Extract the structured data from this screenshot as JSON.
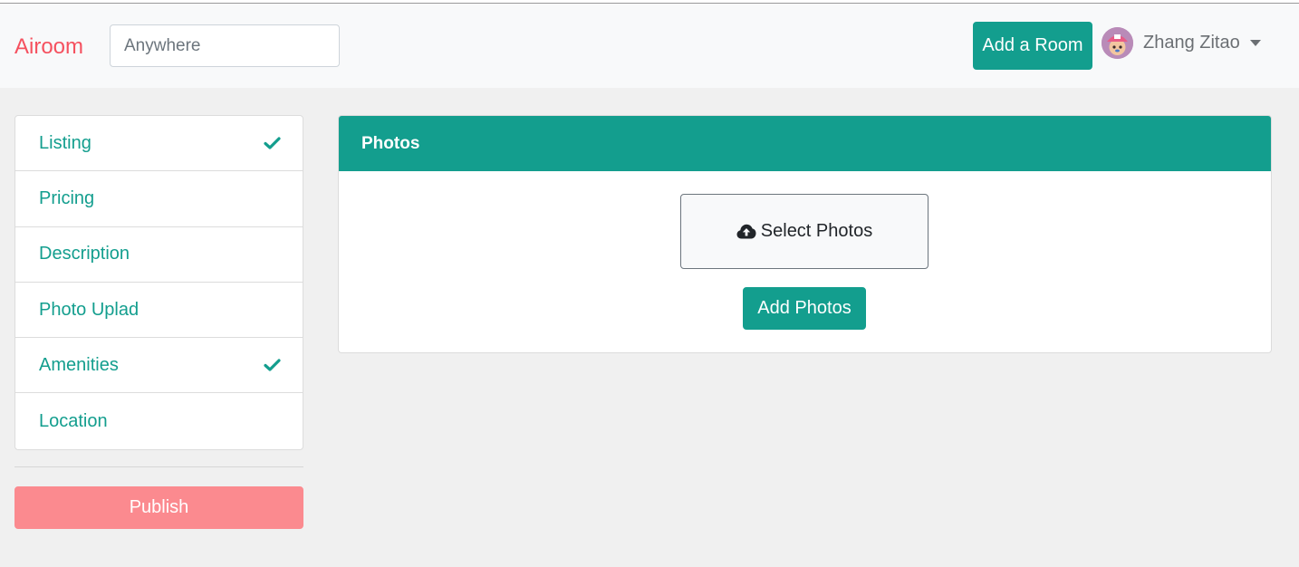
{
  "navbar": {
    "brand": "Airoom",
    "search_placeholder": "Anywhere",
    "add_room_label": "Add a Room",
    "user_name": "Zhang Zitao"
  },
  "sidebar": {
    "items": [
      {
        "label": "Listing",
        "checked": true
      },
      {
        "label": "Pricing",
        "checked": false
      },
      {
        "label": "Description",
        "checked": false
      },
      {
        "label": "Photo Uplad",
        "checked": false
      },
      {
        "label": "Amenities",
        "checked": true
      },
      {
        "label": "Location",
        "checked": false
      }
    ],
    "publish_label": "Publish"
  },
  "photos_card": {
    "title": "Photos",
    "select_label": "Select Photos",
    "add_label": "Add Photos"
  },
  "colors": {
    "accent": "#139e8e",
    "brand": "#f5515f",
    "publish": "#fb8a8f"
  }
}
